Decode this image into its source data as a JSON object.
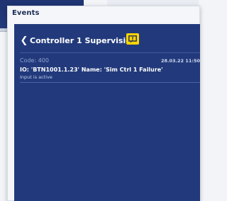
{
  "window": {
    "title": "Events"
  },
  "panel": {
    "title": "Controller 1 Supervision",
    "back_icon": "chevron-left-icon",
    "badge_icon": "alarm-icon"
  },
  "event": {
    "code": "Code: 400",
    "timestamp": "28.03.22 11:50",
    "io_text": "IO: 'BTN1001.1.23' Name: 'Sim Ctrl 1 Failure'",
    "status": "Input is active"
  },
  "colors": {
    "panel_bg": "#223a7c",
    "badge": "#ffd500"
  }
}
